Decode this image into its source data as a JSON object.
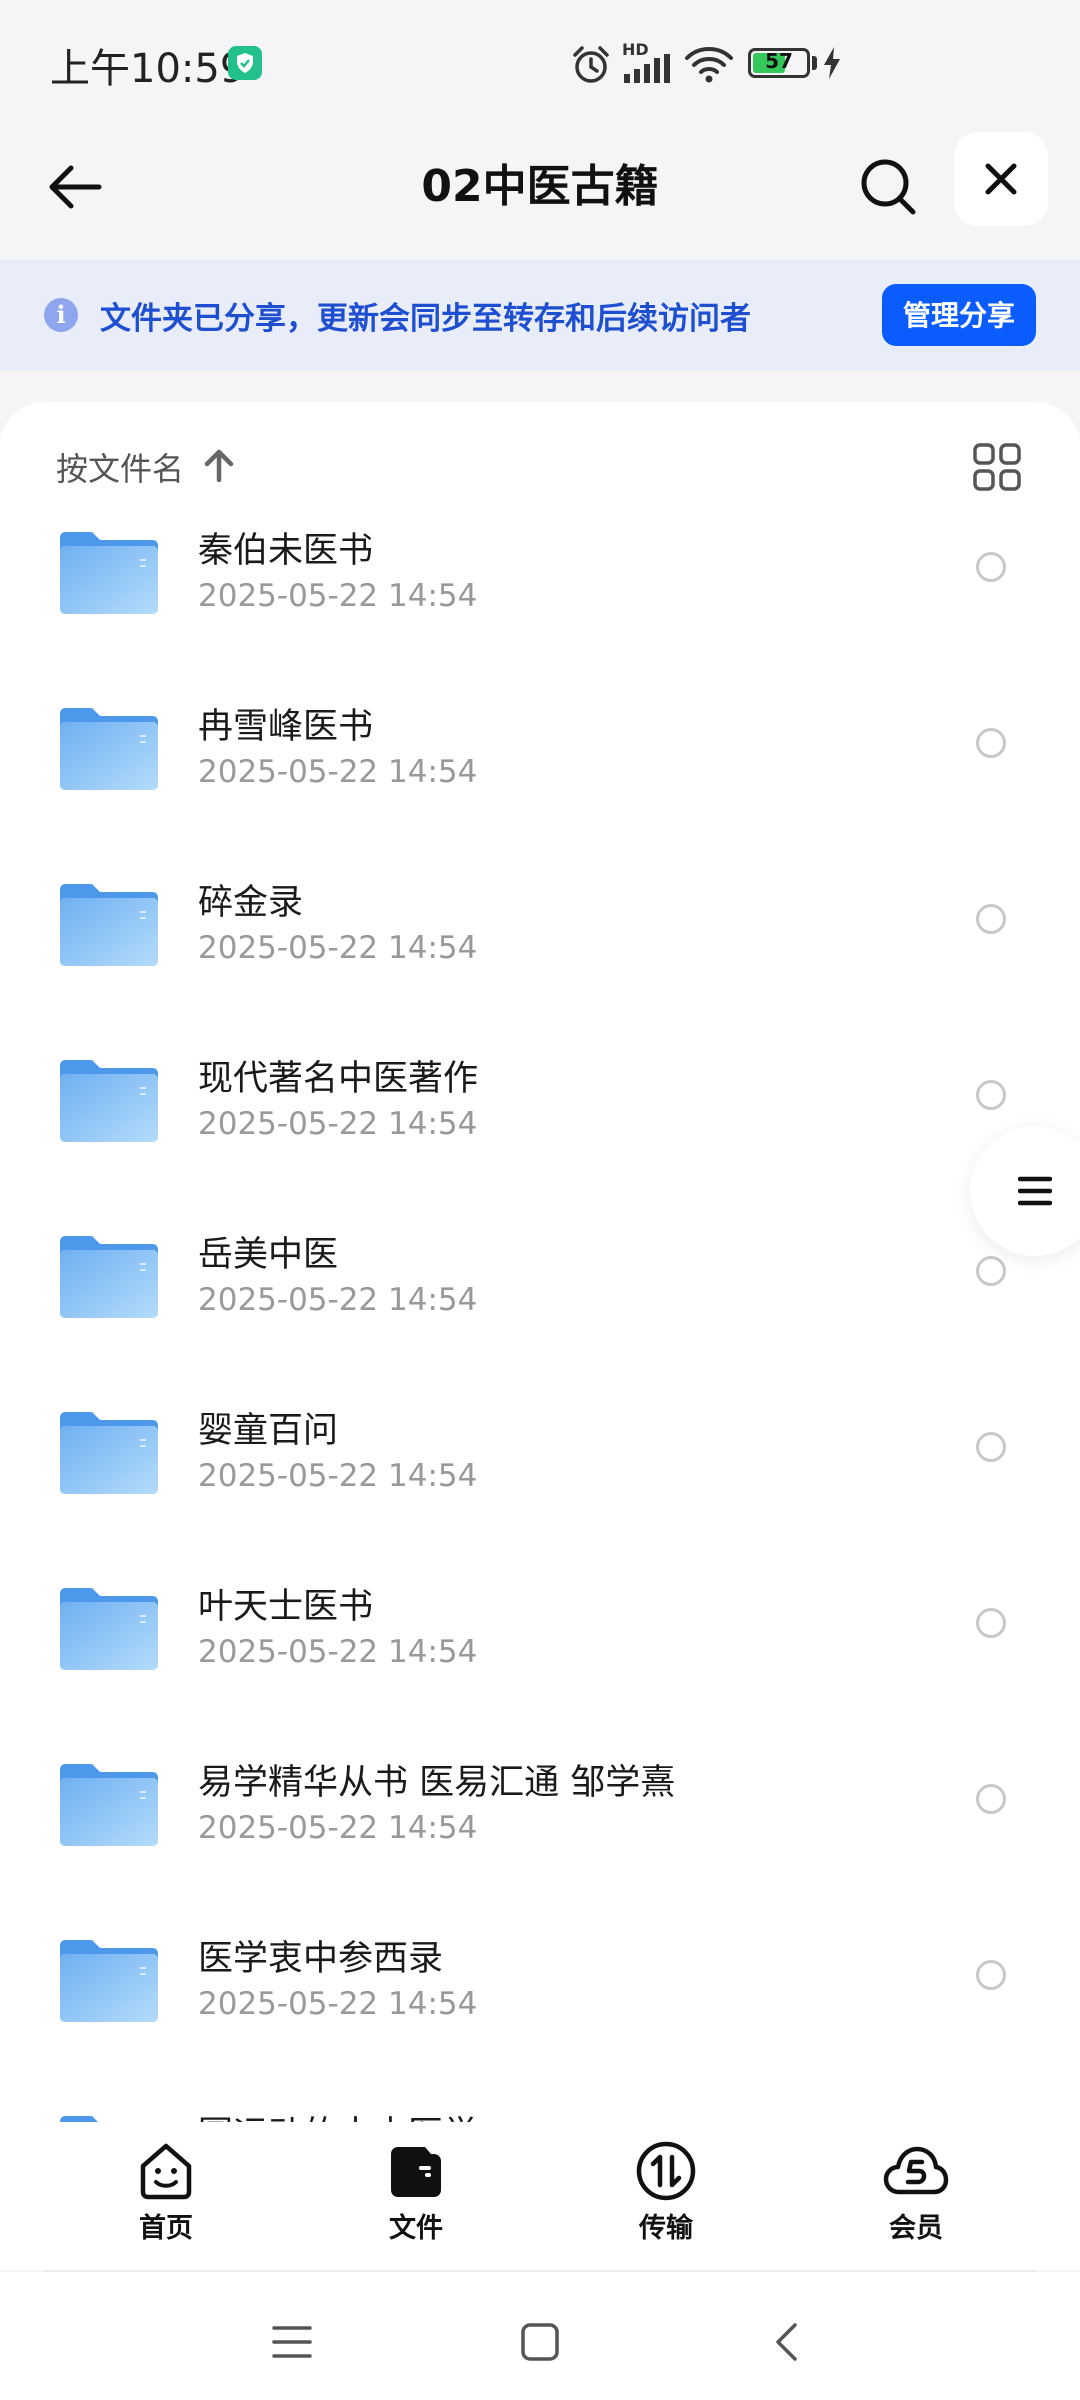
{
  "status_bar": {
    "time": "上午10:59",
    "battery_level": "57",
    "battery_percent": 57,
    "network_badge": "HD",
    "icons": [
      "alarm-icon",
      "signal-icon",
      "wifi-icon",
      "battery-icon",
      "charging-icon"
    ]
  },
  "header": {
    "title": "02中医古籍"
  },
  "share_banner": {
    "message": "文件夹已分享，更新会同步至转存和后续访问者",
    "button_label": "管理分享"
  },
  "sort_bar": {
    "label": "按文件名"
  },
  "files": [
    {
      "name": "秦伯未医书",
      "date": "2025-05-22 14:54"
    },
    {
      "name": "冉雪峰医书",
      "date": "2025-05-22 14:54"
    },
    {
      "name": "碎金录",
      "date": "2025-05-22 14:54"
    },
    {
      "name": "现代著名中医著作",
      "date": "2025-05-22 14:54"
    },
    {
      "name": "岳美中医",
      "date": "2025-05-22 14:54"
    },
    {
      "name": "婴童百问",
      "date": "2025-05-22 14:54"
    },
    {
      "name": "叶天士医书",
      "date": "2025-05-22 14:54"
    },
    {
      "name": "易学精华从书 医易汇通 邹学熹",
      "date": "2025-05-22 14:54"
    },
    {
      "name": "医学衷中参西录",
      "date": "2025-05-22 14:54"
    },
    {
      "name": "圆运动的古中医学",
      "date": ""
    }
  ],
  "bottom_nav": [
    {
      "label": "首页",
      "icon": "home-smile-icon"
    },
    {
      "label": "文件",
      "icon": "wallet-folder-icon"
    },
    {
      "label": "传输",
      "icon": "transfer-icon"
    },
    {
      "label": "会员",
      "icon": "cloud-vip-icon"
    }
  ],
  "colors": {
    "accent": "#0b5cff",
    "banner_bg": "#e9edf9",
    "banner_text": "#1f4fd1",
    "folder": "#6aaef2",
    "date_text": "#999999"
  }
}
